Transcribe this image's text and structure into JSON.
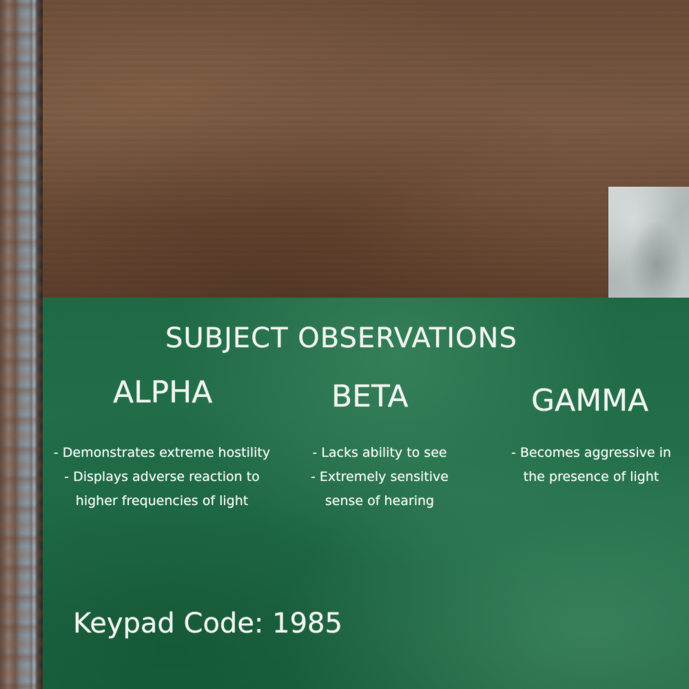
{
  "chalkboard": {
    "title": "SUBJECT OBSERVATIONS",
    "columns": [
      {
        "heading": "ALPHA",
        "lines": [
          "- Demonstrates extreme hostility",
          "- Displays adverse reaction to",
          "higher frequencies of light"
        ]
      },
      {
        "heading": "BETA",
        "lines": [
          "- Lacks ability to see",
          "- Extremely sensitive",
          "sense of hearing"
        ]
      },
      {
        "heading": "GAMMA",
        "lines": [
          "- Becomes aggressive in",
          "the presence of light"
        ]
      }
    ],
    "keypad_code": "Keypad Code: 1985"
  },
  "colors": {
    "chalkboard_green": "#23704b",
    "chalk": "#eef3ee",
    "wood": "#7a5a43",
    "concrete": "#c2c9c8",
    "rusted_pipe": "#6f5f57"
  }
}
